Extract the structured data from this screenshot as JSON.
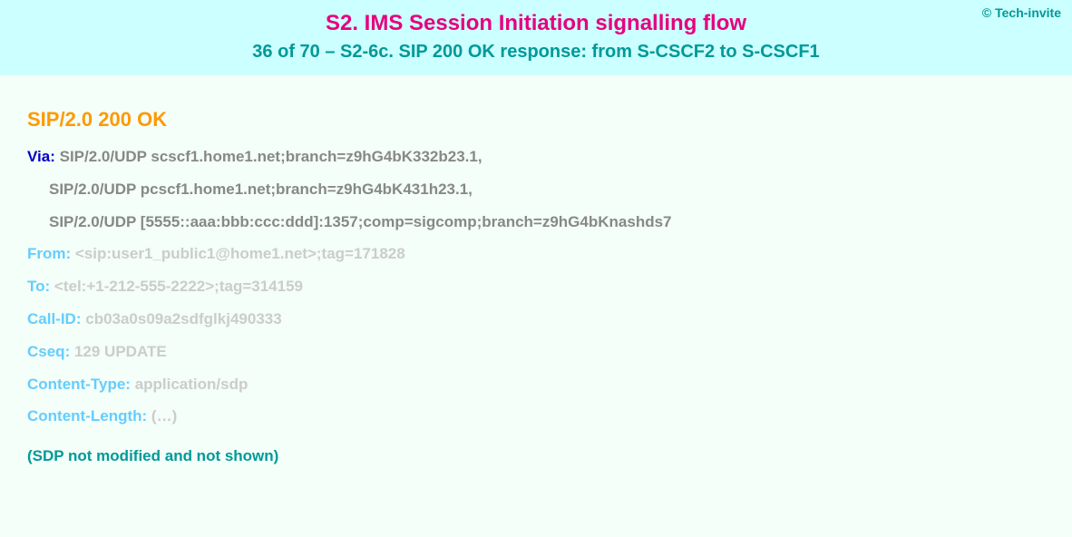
{
  "copyright": "© Tech-invite",
  "title": "S2. IMS Session Initiation signalling flow",
  "subtitle": "36 of 70 – S2-6c. SIP 200 OK response: from S-CSCF2 to S-CSCF1",
  "status_line": "SIP/2.0 200 OK",
  "via": {
    "label": "Via",
    "line1": "SIP/2.0/UDP scscf1.home1.net;branch=z9hG4bK332b23.1,",
    "line2": "SIP/2.0/UDP pcscf1.home1.net;branch=z9hG4bK431h23.1,",
    "line3": "SIP/2.0/UDP [5555::aaa:bbb:ccc:ddd]:1357;comp=sigcomp;branch=z9hG4bKnashds7"
  },
  "from": {
    "label": "From",
    "value": "<sip:user1_public1@home1.net>;tag=171828"
  },
  "to": {
    "label": "To",
    "value": "<tel:+1-212-555-2222>;tag=314159"
  },
  "callid": {
    "label": "Call-ID",
    "value": "cb03a0s09a2sdfglkj490333"
  },
  "cseq": {
    "label": "Cseq",
    "value": "129 UPDATE"
  },
  "ctype": {
    "label": "Content-Type",
    "value": "application/sdp"
  },
  "clen": {
    "label": "Content-Length",
    "value": "(…)"
  },
  "sdp_note": "(SDP not modified and not shown)"
}
